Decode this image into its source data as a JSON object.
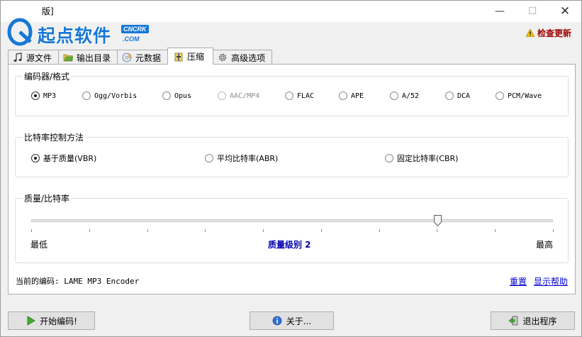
{
  "window": {
    "title": "版]",
    "minimize_glyph": "—",
    "maximize_glyph": "☐",
    "close_glyph": "✕"
  },
  "logo": {
    "text": "起点软件",
    "badge": "CNCRK",
    "domain": ".COM"
  },
  "header": {
    "update_label": "检查更新"
  },
  "tabs": [
    {
      "label": "源文件",
      "icon": "music-note-icon",
      "active": false
    },
    {
      "label": "输出目录",
      "icon": "folder-icon",
      "active": false
    },
    {
      "label": "元数据",
      "icon": "metadata-disc-icon",
      "active": false
    },
    {
      "label": "压缩",
      "icon": "compress-icon",
      "active": true
    },
    {
      "label": "高级选项",
      "icon": "gear-icon",
      "active": false
    }
  ],
  "encoder_group": {
    "title": "编码器/格式",
    "options": [
      {
        "label": "MP3",
        "selected": true,
        "disabled": false
      },
      {
        "label": "Ogg/Vorbis",
        "selected": false,
        "disabled": false
      },
      {
        "label": "Opus",
        "selected": false,
        "disabled": false
      },
      {
        "label": "AAC/MP4",
        "selected": false,
        "disabled": true
      },
      {
        "label": "FLAC",
        "selected": false,
        "disabled": false
      },
      {
        "label": "APE",
        "selected": false,
        "disabled": false
      },
      {
        "label": "A/52",
        "selected": false,
        "disabled": false
      },
      {
        "label": "DCA",
        "selected": false,
        "disabled": false
      },
      {
        "label": "PCM/Wave",
        "selected": false,
        "disabled": false
      }
    ]
  },
  "bitrate_group": {
    "title": "比特率控制方法",
    "options": [
      {
        "label": "基于质量(VBR)",
        "selected": true
      },
      {
        "label": "平均比特率(ABR)",
        "selected": false
      },
      {
        "label": "固定比特率(CBR)",
        "selected": false
      }
    ]
  },
  "quality_group": {
    "title": "质量/比特率",
    "min_label": "最低",
    "max_label": "最高",
    "level_label": "质量级别 2",
    "tick_count": 10,
    "slider_fraction": 0.778
  },
  "status": {
    "current_encoder": "当前的编码: LAME MP3 Encoder",
    "reset_link": "重置",
    "help_link": "显示帮助"
  },
  "buttons": {
    "start": "开始编码!",
    "about": "关于...",
    "exit": "退出程序"
  },
  "colors": {
    "link": "#0000d0",
    "level": "#0000b0",
    "update": "#a00000",
    "logo_blue": "#1677d6"
  }
}
